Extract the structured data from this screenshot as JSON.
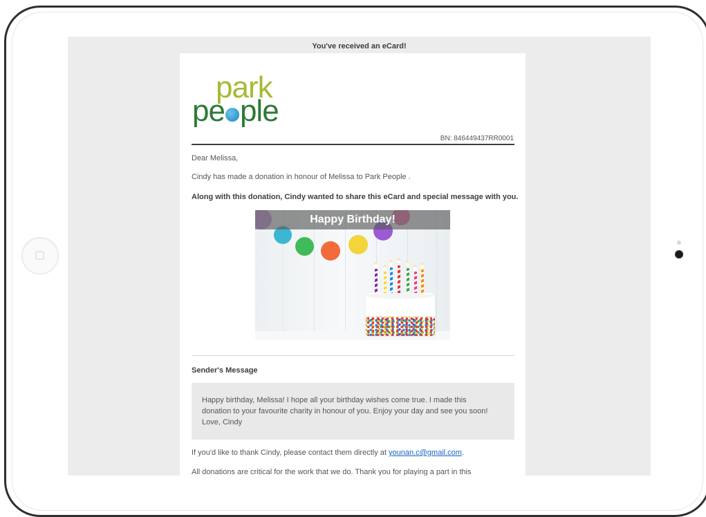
{
  "ecard": {
    "banner": "You've received an eCard!",
    "logo": {
      "line1": "park",
      "line2_a": "pe",
      "line2_b": "ple"
    },
    "bn": "BN: 846449437RR0001",
    "greeting": "Dear Melissa,",
    "intro": "Cindy has made a donation in honour of Melissa to Park People .",
    "share_line": "Along with this donation, Cindy wanted to share this eCard and special message with you.",
    "card_image_title": "Happy Birthday!",
    "sender_heading": "Sender's Message",
    "message_lines": [
      "Happy birthday, Melissa! I hope all your birthday wishes come true. I made this",
      "donation to your favourite charity in honour of you. Enjoy your day and see you soon!",
      "Love, Cindy"
    ],
    "thank_prefix": "If you'd like to thank Cindy, please contact them directly at ",
    "thank_email": "younan.c@gmail.com",
    "thank_suffix": ".",
    "footer_partial": "All donations are critical for the work that we do. Thank you for playing a part in this"
  },
  "colors": {
    "logo_light_green": "#a6ba34",
    "logo_dark_green": "#2d7a35",
    "link_blue": "#1565c0",
    "screen_bg": "#ececec"
  },
  "icons": [
    "home-button-icon",
    "camera-icon",
    "globe-icon",
    "birthday-cake-image"
  ]
}
